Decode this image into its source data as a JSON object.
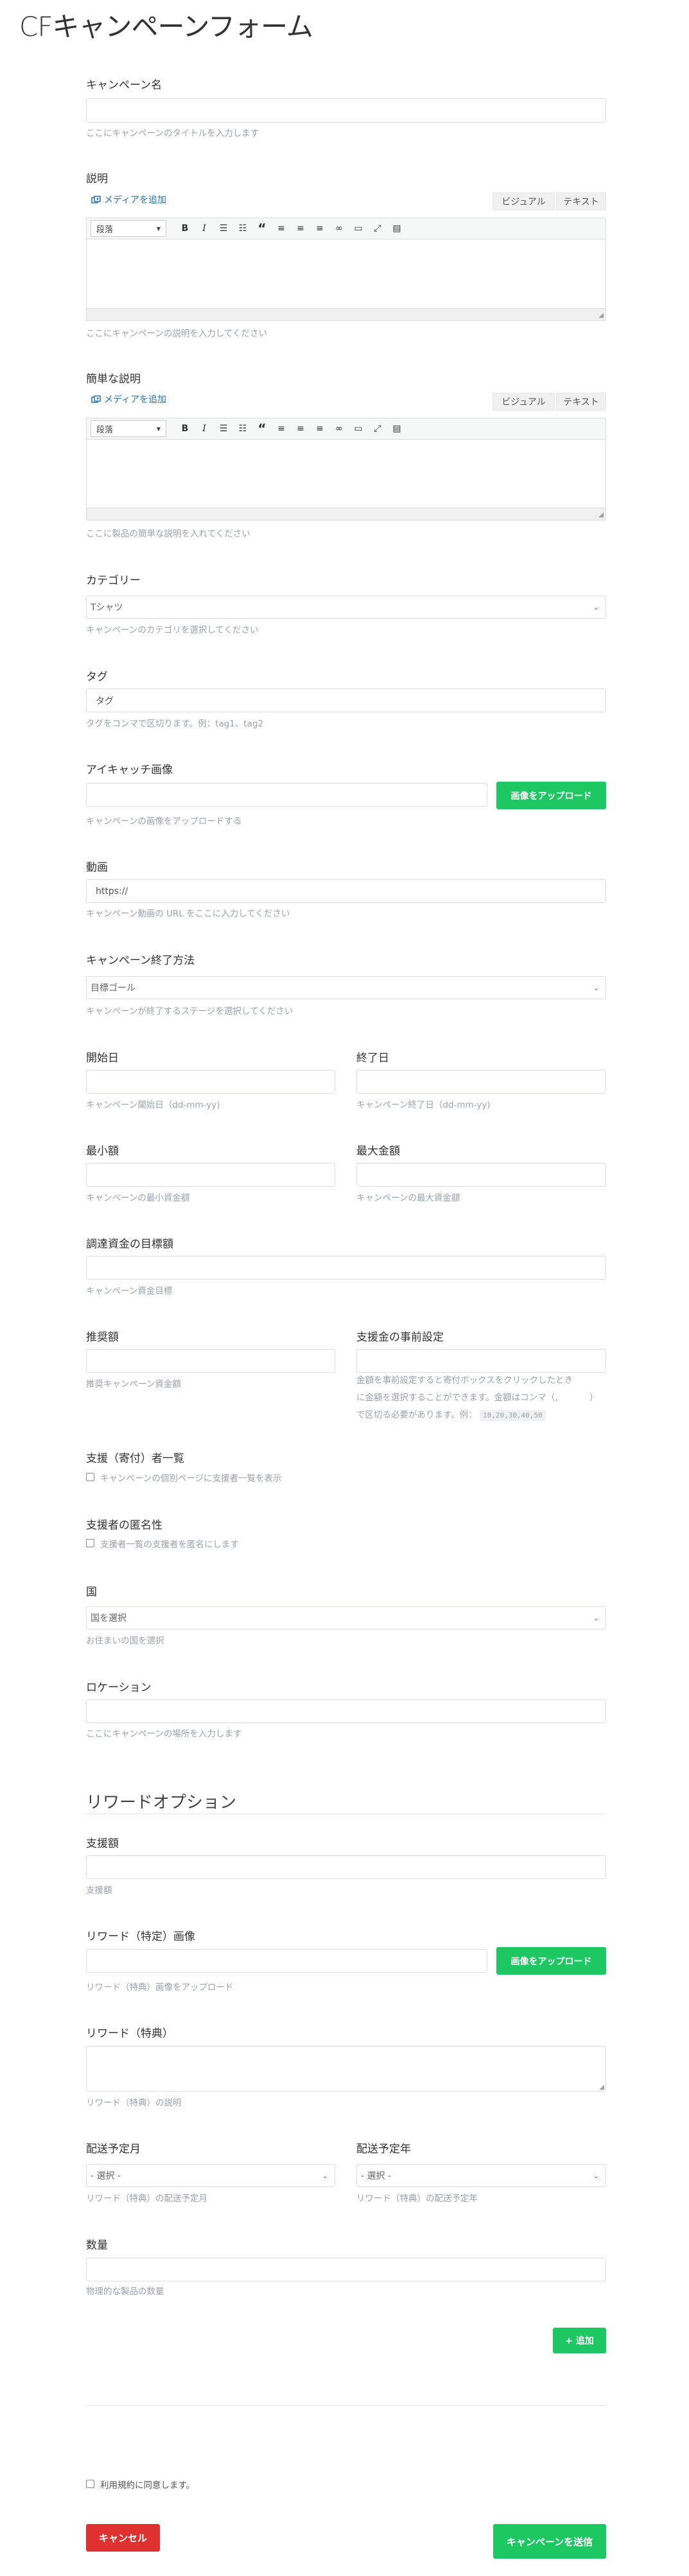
{
  "page": {
    "title": "CFキャンペーンフォーム"
  },
  "campaign_name": {
    "label": "キャンペーン名",
    "value": "",
    "help": "ここにキャンペーンのタイトルを入力します"
  },
  "description": {
    "label": "説明",
    "media_button": "メディアを追加",
    "tab_visual": "ビジュアル",
    "tab_text": "テキスト",
    "format_select": "段落",
    "help": "ここにキャンペーンの説明を入力してください"
  },
  "short_description": {
    "label": "簡単な説明",
    "media_button": "メディアを追加",
    "tab_visual": "ビジュアル",
    "tab_text": "テキスト",
    "format_select": "段落",
    "help": "ここに製品の簡単な説明を入れてください"
  },
  "toolbar_icons": [
    "bold-icon",
    "italic-icon",
    "bullet-list-icon",
    "numbered-list-icon",
    "blockquote-icon",
    "align-left-icon",
    "align-center-icon",
    "align-right-icon",
    "link-icon",
    "read-more-icon",
    "fullscreen-icon",
    "toolbar-toggle-icon"
  ],
  "category": {
    "label": "カテゴリー",
    "selected": "Tシャツ",
    "help": "キャンペーンのカテゴリを選択してください"
  },
  "tags": {
    "label": "タグ",
    "placeholder": "タグ",
    "help": "タグをコンマで区切ります。例：tag1、tag2"
  },
  "featured_image": {
    "label": "アイキャッチ画像",
    "upload_button": "画像をアップロード",
    "help": "キャンペーンの画像をアップロードする"
  },
  "video": {
    "label": "動画",
    "placeholder": "https://",
    "help": "キャンペーン動画の URL をここに入力してください"
  },
  "end_method": {
    "label": "キャンペーン終了方法",
    "selected": "目標ゴール",
    "help": "キャンペーンが終了するステージを選択してください"
  },
  "start_date": {
    "label": "開始日",
    "help": "キャンペーン開始日（dd-mm-yy)"
  },
  "end_date": {
    "label": "終了日",
    "help": "キャンペーン終了日（dd-mm-yy)"
  },
  "min_amount": {
    "label": "最小額",
    "help": "キャンペーンの最小資金額"
  },
  "max_amount": {
    "label": "最大金額",
    "help": "キャンペーンの最大資金額"
  },
  "funding_goal": {
    "label": "調達資金の目標額",
    "help": "キャンペーン資金目標"
  },
  "recommended_amount": {
    "label": "推奨額",
    "help": "推奨キャンペーン資金額"
  },
  "preset_amounts": {
    "label": "支援金の事前設定",
    "help_1": "金額を事前設定すると寄付ボックスをクリックしたとき",
    "help_2": "に金額を選択することができます。金額はコンマ（,",
    "help_3": "）",
    "help_4": "で区切る必要があります。例：",
    "example": "10,20,30,40,50"
  },
  "backers_list": {
    "label": "支援（寄付）者一覧",
    "checkbox_label": "キャンペーンの個別ページに支援者一覧を表示"
  },
  "backer_anonymity": {
    "label": "支援者の匿名性",
    "checkbox_label": "支援者一覧の支援者を匿名にします"
  },
  "country": {
    "label": "国",
    "selected": "国を選択",
    "help": "お住まいの国を選択"
  },
  "location": {
    "label": "ロケーション",
    "help": "ここにキャンペーンの場所を入力します"
  },
  "reward_section": {
    "title": "リワードオプション"
  },
  "pledge_amount": {
    "label": "支援額",
    "help": "支援額"
  },
  "reward_image": {
    "label": "リワード（特定）画像",
    "upload_button": "画像をアップロード",
    "help": "リワード（特典）画像をアップロード"
  },
  "reward": {
    "label": "リワード（特典）",
    "help": "リワード（特典）の説明"
  },
  "delivery_month": {
    "label": "配送予定月",
    "selected": "- 選択 -",
    "help": "リワード（特典）の配送予定月"
  },
  "delivery_year": {
    "label": "配送予定年",
    "selected": "- 選択 -",
    "help": "リワード（特典）の配送予定年"
  },
  "quantity": {
    "label": "数量",
    "help": "物理的な製品の数量"
  },
  "add_button": "+ 追加",
  "terms": {
    "checkbox_label": "利用規約に同意します。"
  },
  "cancel_button": "キャンセル",
  "submit_button": "キャンペーンを送信",
  "colors": {
    "green": "#1dc762",
    "red": "#e03131",
    "help_text": "#9aa3ac",
    "link_blue": "#2271b1"
  }
}
